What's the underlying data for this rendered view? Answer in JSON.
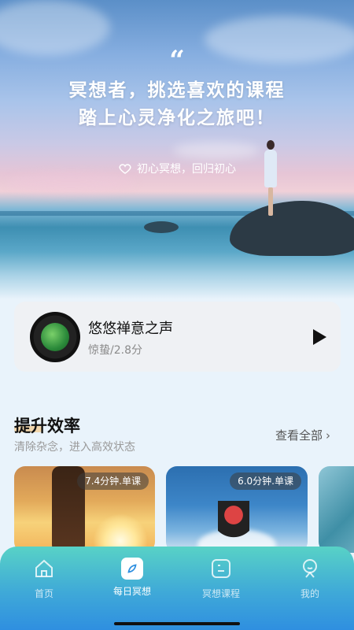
{
  "hero": {
    "quote": "“",
    "title_line1": "冥想者，挑选喜欢的课程",
    "title_line2": "踏上心灵净化之旅吧！",
    "tagline": "初心冥想，回归初心"
  },
  "player": {
    "title": "悠悠禅意之声",
    "subtitle": "惊蛰/2.8分"
  },
  "section": {
    "title": "提升效率",
    "subtitle": "清除杂念，进入高效状态",
    "see_all": "查看全部"
  },
  "cards": [
    {
      "badge": "7.4分钟.单课"
    },
    {
      "badge": "6.0分钟.单课"
    },
    {
      "badge": ""
    }
  ],
  "nav": {
    "items": [
      {
        "label": "首页",
        "icon": "home-icon"
      },
      {
        "label": "每日冥想",
        "icon": "compass-leaf-icon"
      },
      {
        "label": "冥想课程",
        "icon": "course-icon"
      },
      {
        "label": "我的",
        "icon": "profile-icon"
      }
    ],
    "active_index": 1
  },
  "colors": {
    "accent": "#2f8fe0",
    "nav_top": "#58d2c6",
    "highlight": "#f4cf9a"
  }
}
